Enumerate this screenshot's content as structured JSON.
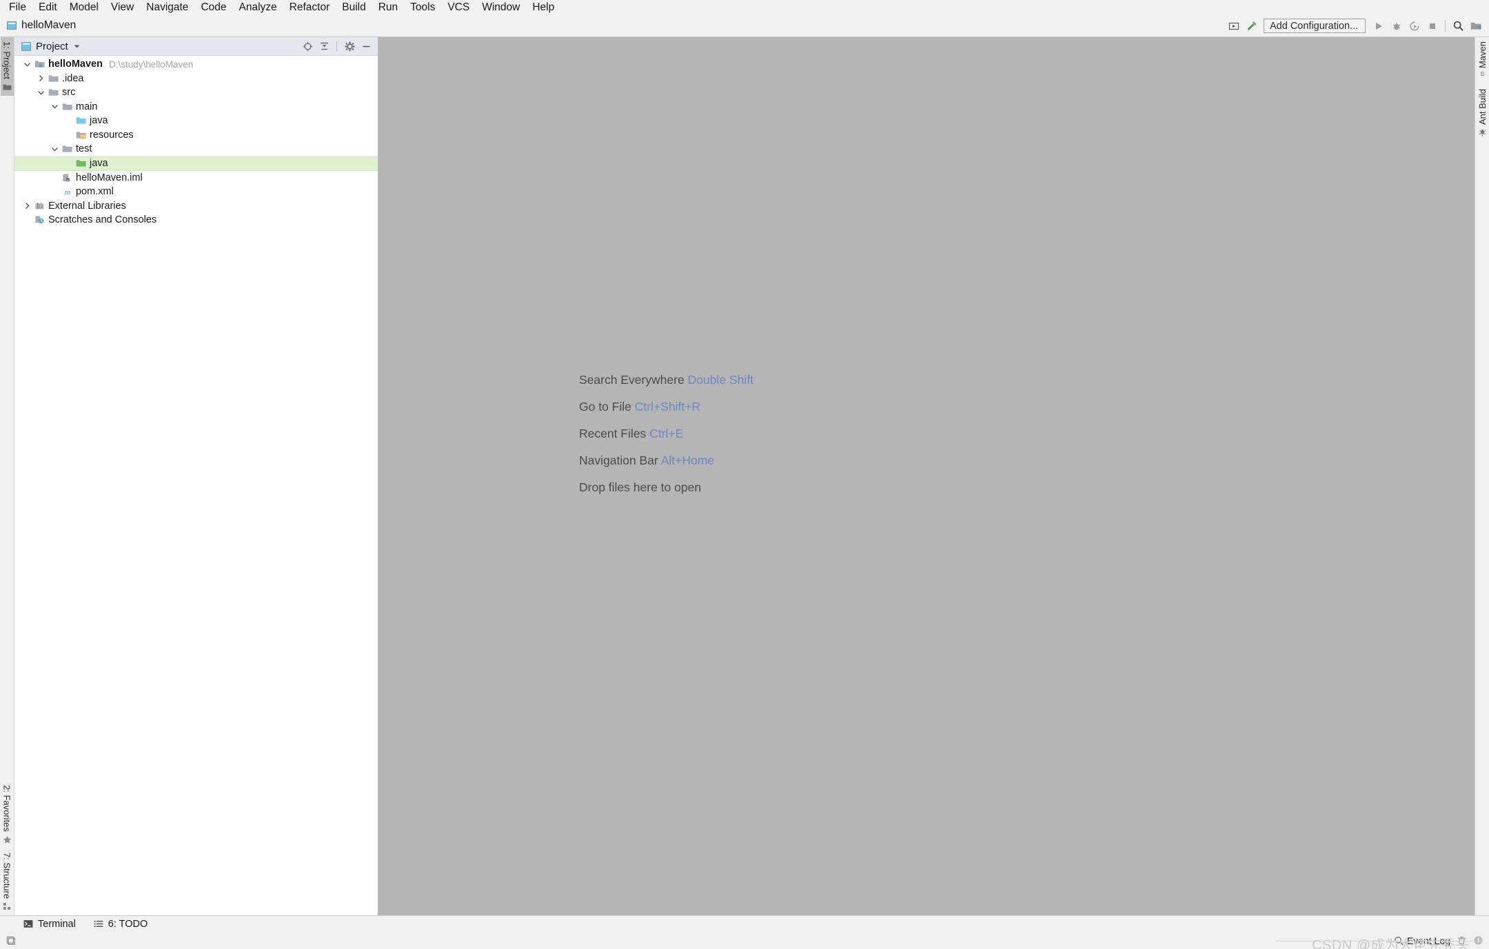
{
  "menubar": {
    "items": [
      {
        "label": "File",
        "mnemonic": "F"
      },
      {
        "label": "Edit",
        "mnemonic": "E"
      },
      {
        "label": "Model",
        "mnemonic": ""
      },
      {
        "label": "View",
        "mnemonic": "V"
      },
      {
        "label": "Navigate",
        "mnemonic": "N"
      },
      {
        "label": "Code",
        "mnemonic": "C"
      },
      {
        "label": "Analyze",
        "mnemonic": "z"
      },
      {
        "label": "Refactor",
        "mnemonic": "R"
      },
      {
        "label": "Build",
        "mnemonic": "B"
      },
      {
        "label": "Run",
        "mnemonic": "u"
      },
      {
        "label": "Tools",
        "mnemonic": "T"
      },
      {
        "label": "VCS",
        "mnemonic": "S"
      },
      {
        "label": "Window",
        "mnemonic": "W"
      },
      {
        "label": "Help",
        "mnemonic": "H"
      }
    ]
  },
  "titlebar": {
    "project_name": "helloMaven",
    "window_icon": "window-icon"
  },
  "toolbar": {
    "run_config_icon": "run-configuration-selector-icon",
    "build_icon": "build-hammer-icon",
    "add_configuration_label": "Add Configuration...",
    "run_icon": "run-icon",
    "debug_icon": "debug-icon",
    "coverage_icon": "run-with-coverage-icon",
    "stop_icon": "stop-icon",
    "search_icon": "search-everywhere-icon",
    "project_structure_icon": "project-structure-icon"
  },
  "left_stripe": {
    "top_tabs": [
      {
        "label": "1: Project",
        "mnemonic": "1",
        "icon": "project-folder-icon",
        "active": true
      }
    ],
    "bottom_tabs": [
      {
        "label": "2: Favorites",
        "mnemonic": "2",
        "icon": "favorites-star-icon",
        "active": false
      },
      {
        "label": "7: Structure",
        "mnemonic": "7",
        "icon": "structure-icon",
        "active": false
      }
    ]
  },
  "right_stripe": {
    "tabs": [
      {
        "label": "Maven",
        "icon": "maven-m-icon"
      },
      {
        "label": "Ant Build",
        "icon": "ant-build-icon"
      }
    ]
  },
  "project_panel": {
    "title": "Project",
    "title_icon": "project-view-icon",
    "dropdown_icon": "chevron-down-icon",
    "actions": [
      {
        "name": "select-opened-file-icon",
        "label": "Select Opened File"
      },
      {
        "name": "collapse-all-icon",
        "label": "Collapse All"
      },
      {
        "name": "settings-gear-icon",
        "label": "Settings"
      },
      {
        "name": "hide-icon",
        "label": "Hide"
      }
    ],
    "tree": [
      {
        "label": "helloMaven",
        "path": "D:\\study\\helloMaven",
        "indent": 0,
        "arrow": "down",
        "icon": "module-folder-icon",
        "bold": true,
        "selected": false
      },
      {
        "label": ".idea",
        "path": "",
        "indent": 1,
        "arrow": "right",
        "icon": "folder-icon",
        "bold": false,
        "selected": false
      },
      {
        "label": "src",
        "path": "",
        "indent": 1,
        "arrow": "down",
        "icon": "folder-icon",
        "bold": false,
        "selected": false
      },
      {
        "label": "main",
        "path": "",
        "indent": 2,
        "arrow": "down",
        "icon": "folder-icon",
        "bold": false,
        "selected": false
      },
      {
        "label": "java",
        "path": "",
        "indent": 3,
        "arrow": "none",
        "icon": "source-root-blue-icon",
        "bold": false,
        "selected": false
      },
      {
        "label": "resources",
        "path": "",
        "indent": 3,
        "arrow": "none",
        "icon": "resource-root-icon",
        "bold": false,
        "selected": false
      },
      {
        "label": "test",
        "path": "",
        "indent": 2,
        "arrow": "down",
        "icon": "folder-icon",
        "bold": false,
        "selected": false
      },
      {
        "label": "java",
        "path": "",
        "indent": 3,
        "arrow": "none",
        "icon": "test-source-root-green-icon",
        "bold": false,
        "selected": true
      },
      {
        "label": "helloMaven.iml",
        "path": "",
        "indent": 2,
        "arrow": "none",
        "icon": "iml-module-file-icon",
        "bold": false,
        "selected": false
      },
      {
        "label": "pom.xml",
        "path": "",
        "indent": 2,
        "arrow": "none",
        "icon": "maven-pom-icon",
        "bold": false,
        "selected": false
      },
      {
        "label": "External Libraries",
        "path": "",
        "indent": 0,
        "arrow": "right",
        "icon": "external-libraries-icon",
        "bold": false,
        "selected": false
      },
      {
        "label": "Scratches and Consoles",
        "path": "",
        "indent": 0,
        "arrow": "none",
        "icon": "scratches-icon",
        "bold": false,
        "selected": false
      }
    ]
  },
  "editor": {
    "hints": [
      {
        "action": "Search Everywhere",
        "shortcut": "Double Shift"
      },
      {
        "action": "Go to File",
        "shortcut": "Ctrl+Shift+R"
      },
      {
        "action": "Recent Files",
        "shortcut": "Ctrl+E"
      },
      {
        "action": "Navigation Bar",
        "shortcut": "Alt+Home"
      },
      {
        "action": "Drop files here to open",
        "shortcut": ""
      }
    ]
  },
  "bottom_tabs": [
    {
      "label": "Terminal",
      "mnemonic": "",
      "icon": "terminal-icon"
    },
    {
      "label": "6: TODO",
      "mnemonic": "6",
      "icon": "todo-list-icon"
    }
  ],
  "statusbar": {
    "left_icon": "toggle-toolwindows-icon",
    "event_log_label": "Event Log",
    "event_log_icon": "event-log-search-icon",
    "trash_icon": "trash-icon",
    "warning_icon": "warning-icon",
    "watermark": "CSDN @成为大佬先秃头"
  },
  "colors": {
    "editor_background": "#b5b5b5",
    "panel_header": "#e4e7ed",
    "selection_green": "#dff0d0",
    "shortcut_blue": "#6e86c2",
    "chrome": "#f0f0f0"
  }
}
